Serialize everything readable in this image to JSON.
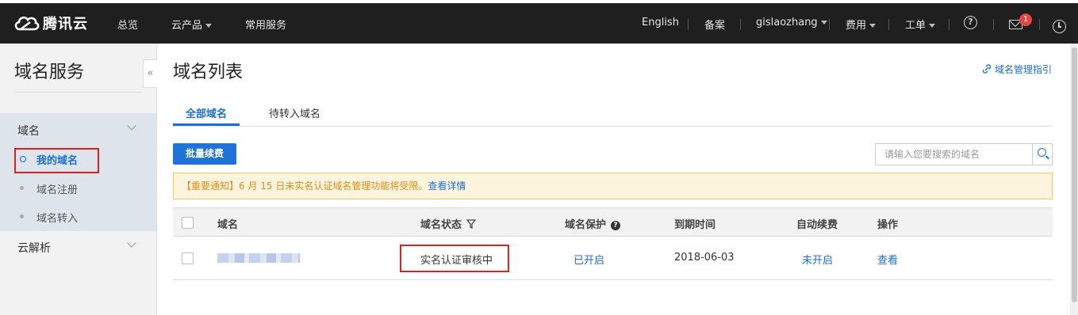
{
  "topbar": {
    "brand": "腾讯云",
    "nav": [
      "总览",
      "云产品",
      "常用服务"
    ],
    "right": {
      "language": "English",
      "beian": "备案",
      "user": "gislaozhang",
      "billing": "费用",
      "ticket": "工单",
      "help_icon": "question-circle-icon",
      "mail_badge": "1"
    }
  },
  "sidebar": {
    "title": "域名服务",
    "collapse_glyph": "«",
    "groups": [
      {
        "label": "域名",
        "items": [
          {
            "label": "我的域名",
            "active": true
          },
          {
            "label": "域名注册",
            "active": false
          },
          {
            "label": "域名转入",
            "active": false
          }
        ]
      },
      {
        "label": "云解析",
        "items": []
      }
    ]
  },
  "main": {
    "title": "域名列表",
    "guide_link": "域名管理指引",
    "tabs": [
      {
        "label": "全部域名",
        "active": true
      },
      {
        "label": "待转入域名",
        "active": false
      }
    ],
    "batch_renew": "批量续费",
    "search": {
      "placeholder": "请输入您要搜索的域名",
      "value": ""
    },
    "notice": {
      "text": "【重要通知】6 月 15 日未实名认证域名管理功能将受限。",
      "link": "查看详情"
    },
    "table": {
      "headers": [
        "域名",
        "域名状态",
        "域名保护",
        "到期时间",
        "自动续费",
        "操作"
      ],
      "rows": [
        {
          "status": "实名认证审核中",
          "protection": "已开启",
          "expiry": "2018-06-03",
          "auto_renew": "未开启",
          "action": "查看"
        }
      ]
    }
  },
  "colors": {
    "topbar_bg": "#1f1f1f",
    "accent_blue": "#1b6ed6",
    "highlight_red": "#e02020",
    "notice_bg": "#fdf4dd",
    "notice_text": "#e38c1b"
  }
}
